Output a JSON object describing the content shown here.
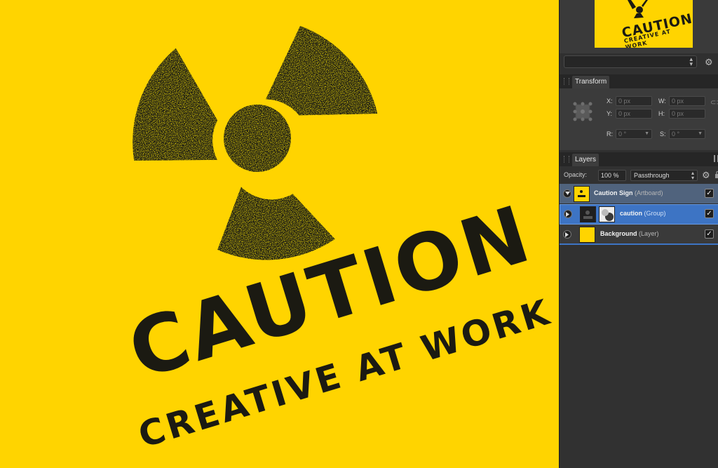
{
  "canvas": {
    "background_color": "#FFD400",
    "ink_color": "#1b1a12",
    "symbol": "radiation-trefoil-icon",
    "headline": "CAUTION",
    "subline": "CREATIVE AT WORK"
  },
  "navigator": {
    "thumb_headline": "CAUTION",
    "thumb_subline": "CREATIVE AT WORK",
    "dropdown_value": ""
  },
  "transform": {
    "tab_label": "Transform",
    "x_label": "X:",
    "x_value": "0 px",
    "y_label": "Y:",
    "y_value": "0 px",
    "w_label": "W:",
    "w_value": "0 px",
    "h_label": "H:",
    "h_value": "0 px",
    "r_label": "R:",
    "r_value": "0 °",
    "s_label": "S:",
    "s_value": "0 °"
  },
  "layers": {
    "tab_label": "Layers",
    "opacity_label": "Opacity:",
    "opacity_value": "100 %",
    "blend_mode": "Passthrough",
    "items": [
      {
        "name": "Caution Sign",
        "kind": "(Artboard)",
        "checked": "✓",
        "selected": false
      },
      {
        "name": "caution",
        "kind": "(Group)",
        "checked": "✓",
        "selected": true
      },
      {
        "name": "Background",
        "kind": "(Layer)",
        "checked": "✓",
        "selected": false
      }
    ]
  },
  "colors": {
    "panel_bg": "#303030",
    "selected_row": "#3d74c4",
    "artboard_row": "#50637d"
  }
}
